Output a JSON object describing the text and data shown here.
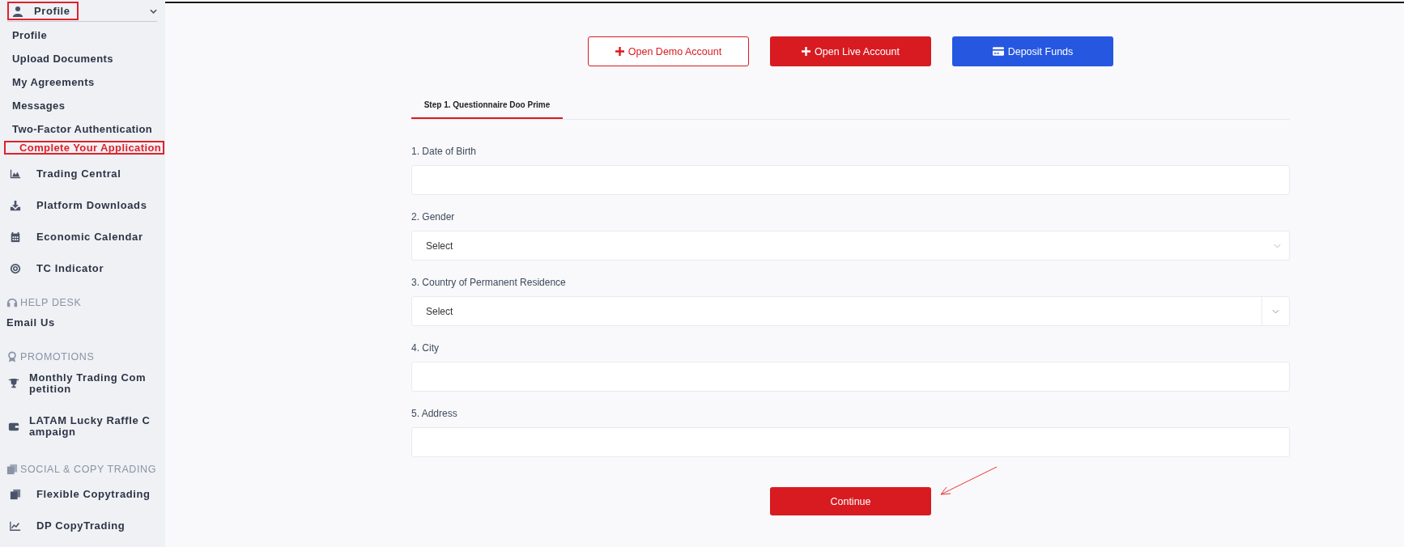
{
  "sidebar": {
    "profile_menu": {
      "label": "Profile",
      "expanded": true,
      "highlighted": true,
      "items": [
        {
          "label": "Profile",
          "selected": false,
          "highlighted": false
        },
        {
          "label": "Upload Documents",
          "selected": false,
          "highlighted": false
        },
        {
          "label": "My Agreements",
          "selected": false,
          "highlighted": false
        },
        {
          "label": "Messages",
          "selected": false,
          "highlighted": false
        },
        {
          "label": "Two-Factor Authentication",
          "selected": false,
          "highlighted": false
        },
        {
          "label": "Complete Your Application",
          "selected": true,
          "highlighted": true
        }
      ]
    },
    "nav": [
      {
        "label": "Trading Central"
      },
      {
        "label": "Platform Downloads"
      },
      {
        "label": "Economic Calendar"
      },
      {
        "label": "TC Indicator"
      }
    ],
    "sections": [
      {
        "title": "HELP DESK",
        "items": [
          {
            "label": "Email Us",
            "kind": "plain"
          }
        ]
      },
      {
        "title": "PROMOTIONS",
        "items": [
          {
            "label": "Monthly Trading Competition",
            "kind": "wrapped"
          },
          {
            "label": "LATAM Lucky Raffle Campaign",
            "kind": "wrapped"
          }
        ]
      },
      {
        "title": "SOCIAL & COPY TRADING",
        "items": [
          {
            "label": "Flexible Copytrading",
            "kind": "icon"
          },
          {
            "label": "DP CopyTrading",
            "kind": "icon"
          }
        ]
      }
    ]
  },
  "actions": [
    {
      "label": "Open Demo Account",
      "kind": "outline"
    },
    {
      "label": "Open Live Account",
      "kind": "primary"
    },
    {
      "label": "Deposit Funds",
      "kind": "deposit"
    }
  ],
  "tabs": [
    {
      "label": "Step 1. Questionnaire Doo Prime",
      "selected": true
    }
  ],
  "fields": [
    {
      "label": "1. Date of Birth",
      "kind": "text"
    },
    {
      "label": "2. Gender",
      "kind": "select",
      "value": "Select"
    },
    {
      "label": "3. Country of Permanent Residence",
      "kind": "select-addon",
      "value": "Select"
    },
    {
      "label": "4. City",
      "kind": "text"
    },
    {
      "label": "5. Address",
      "kind": "text"
    }
  ],
  "submit_button": "Continue"
}
